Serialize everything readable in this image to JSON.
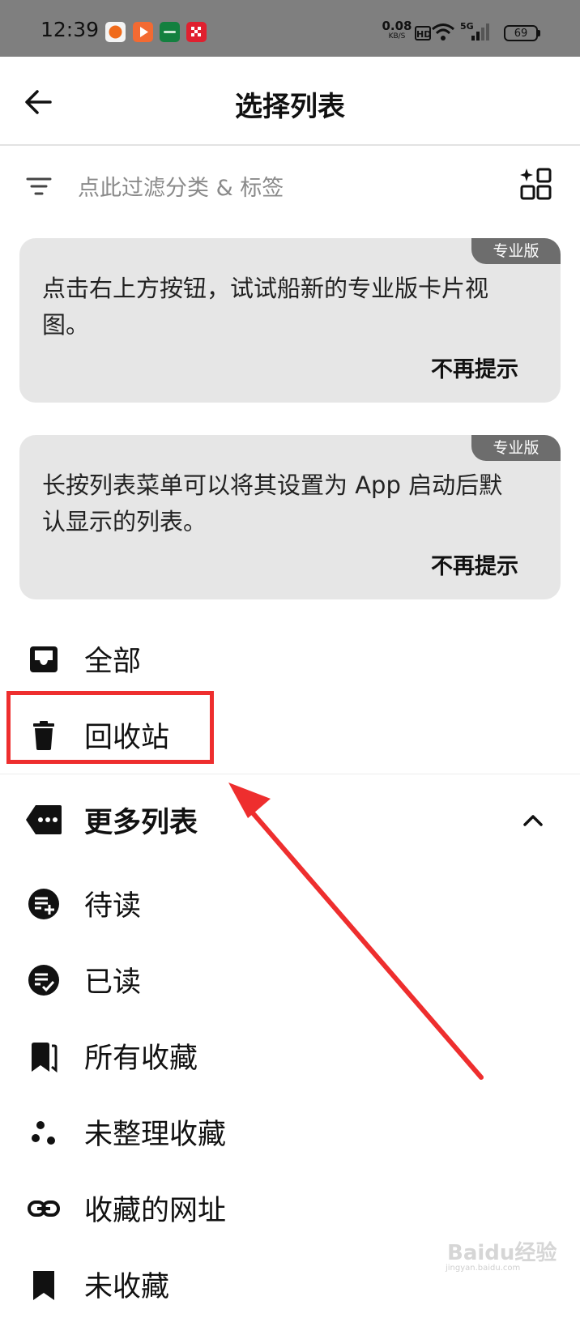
{
  "status_bar": {
    "time": "12:39",
    "net_speed_value": "0.08",
    "net_speed_unit": "KB/S",
    "hd_label": "HD",
    "network_label": "5G",
    "battery": "69",
    "app_icons": [
      "scoring-app-icon",
      "video-app-icon",
      "oppo-app-icon",
      "game-app-icon"
    ]
  },
  "header": {
    "title": "选择列表"
  },
  "filter": {
    "placeholder": "点此过滤分类 & 标签"
  },
  "tips": [
    {
      "badge": "专业版",
      "text": "点击右上方按钮，试试船新的专业版卡片视图。",
      "dismiss": "不再提示"
    },
    {
      "badge": "专业版",
      "text": "长按列表菜单可以将其设置为 App 启动后默认显示的列表。",
      "dismiss": "不再提示"
    }
  ],
  "lists": {
    "all": "全部",
    "trash": "回收站"
  },
  "more_lists": {
    "label": "更多列表",
    "items": [
      "待读",
      "已读",
      "所有收藏",
      "未整理收藏",
      "收藏的网址",
      "未收藏"
    ]
  },
  "watermark": {
    "text": "Baidu经验",
    "sub": "jingyan.baidu.com"
  },
  "colors": {
    "highlight": "#ee2e2e",
    "card_bg": "#e6e6e6",
    "badge_bg": "#6d6d6d",
    "status_bg": "#7f7f7f"
  }
}
